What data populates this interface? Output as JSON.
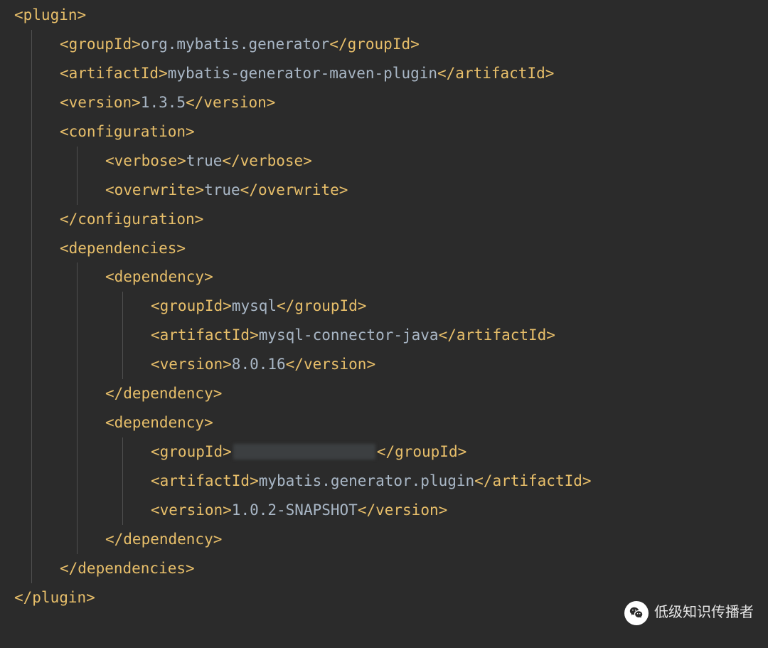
{
  "tags": {
    "plugin_open": "<plugin>",
    "plugin_close": "</plugin>",
    "groupId_open": "<groupId>",
    "groupId_close": "</groupId>",
    "artifactId_open": "<artifactId>",
    "artifactId_close": "</artifactId>",
    "version_open": "<version>",
    "version_close": "</version>",
    "configuration_open": "<configuration>",
    "configuration_close": "</configuration>",
    "verbose_open": "<verbose>",
    "verbose_close": "</verbose>",
    "overwrite_open": "<overwrite>",
    "overwrite_close": "</overwrite>",
    "dependencies_open": "<dependencies>",
    "dependencies_close": "</dependencies>",
    "dependency_open": "<dependency>",
    "dependency_close": "</dependency>"
  },
  "plugin": {
    "groupId": "org.mybatis.generator",
    "artifactId": "mybatis-generator-maven-plugin",
    "version": "1.3.5",
    "configuration": {
      "verbose": "true",
      "overwrite": "true"
    },
    "dependencies": [
      {
        "groupId": "mysql",
        "artifactId": "mysql-connector-java",
        "version": "8.0.16"
      },
      {
        "groupId_redacted": true,
        "artifactId": "mybatis.generator.plugin",
        "version": "1.0.2-SNAPSHOT"
      }
    ]
  },
  "watermark": "低级知识传播者"
}
